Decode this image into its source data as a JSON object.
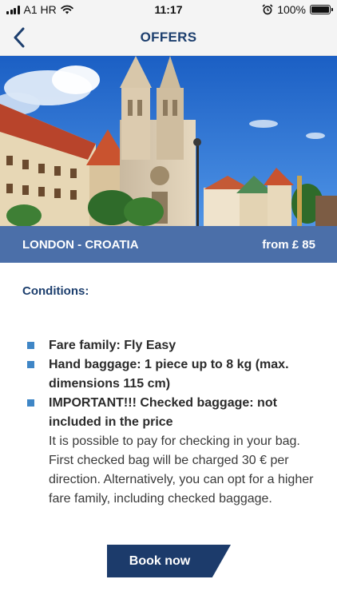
{
  "status_bar": {
    "carrier": "A1 HR",
    "time": "11:17",
    "battery_percent": "100%",
    "battery_level": 1.0,
    "icons": [
      "signal-icon",
      "wifi-icon",
      "alarm-icon",
      "battery-icon"
    ]
  },
  "nav": {
    "title": "OFFERS",
    "back_icon": "chevron-left-icon"
  },
  "hero": {
    "image": "zagreb-cathedral-photo"
  },
  "route": {
    "name": "LONDON - CROATIA",
    "price": "from £ 85"
  },
  "conditions": {
    "title": "Conditions:",
    "items": [
      {
        "title": "Fare family: Fly Easy",
        "description": ""
      },
      {
        "title": "Hand baggage: 1 piece up to 8 kg (max. dimensions 115 cm)",
        "description": ""
      },
      {
        "title": "IMPORTANT!!! Checked baggage: not included in the price",
        "description": "It is possible to pay for checking in your bag. First checked bag will be charged 30 € per direction. Alternatively, you can opt for a higher fare family, including checked baggage."
      }
    ]
  },
  "actions": {
    "book_now": "Book now"
  },
  "colors": {
    "brand_navy": "#1c3b6b",
    "title_blue": "#1d3f6e",
    "route_bar": "#4b6fa9",
    "bullet": "#3f86c6"
  }
}
